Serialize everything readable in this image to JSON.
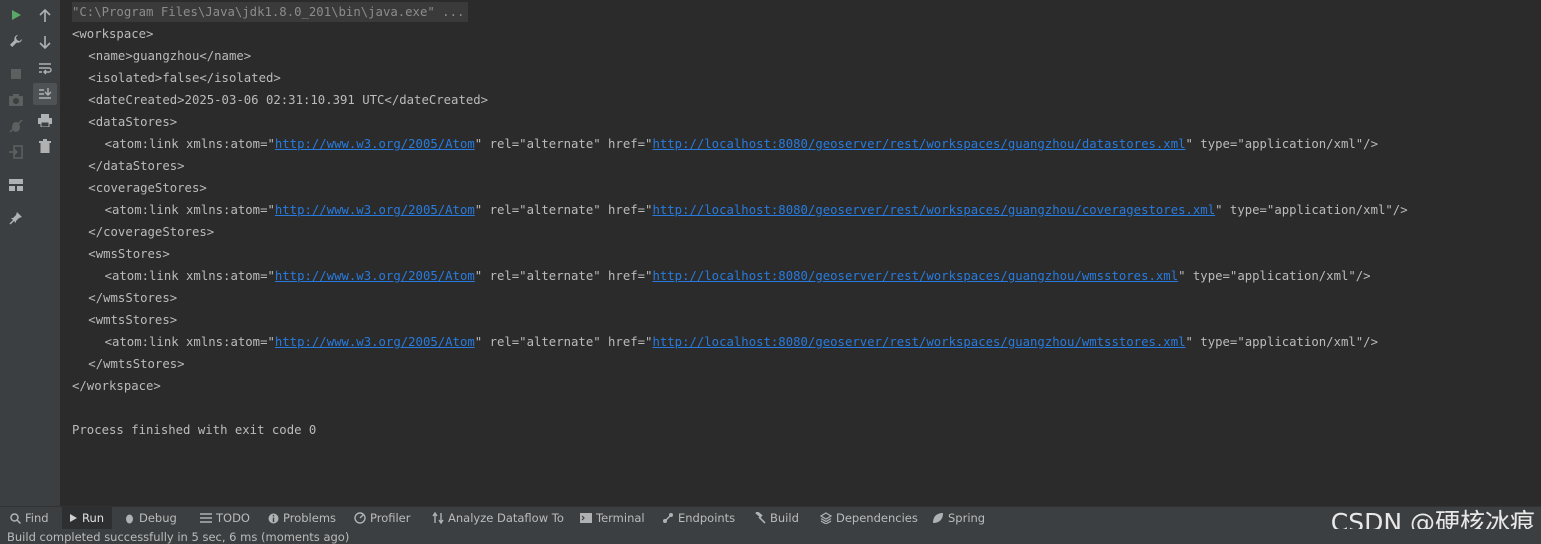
{
  "toolbar_left": {
    "icons": [
      "run-icon",
      "wrench-icon",
      "stop-icon",
      "camera-icon",
      "bug-exclude-icon",
      "login-icon",
      "layout-icon",
      "pin-icon"
    ]
  },
  "toolbar_left2": {
    "icons": [
      "arrow-up-icon",
      "arrow-down-icon",
      "soft-wrap-icon",
      "scroll-to-end-icon",
      "print-icon",
      "trash-icon"
    ]
  },
  "console": {
    "command": "\"C:\\Program Files\\Java\\jdk1.8.0_201\\bin\\java.exe\" ...",
    "lines": [
      {
        "indent": 0,
        "text": "<workspace>"
      },
      {
        "indent": 1,
        "text": "<name>guangzhou</name>"
      },
      {
        "indent": 1,
        "text": "<isolated>false</isolated>"
      },
      {
        "indent": 1,
        "text": "<dateCreated>2025-03-06 02:31:10.391 UTC</dateCreated>"
      },
      {
        "indent": 1,
        "text": "<dataStores>"
      },
      {
        "indent": 2,
        "pre": "<atom:link xmlns:atom=\"",
        "link1": "http://www.w3.org/2005/Atom",
        "mid": "\" rel=\"alternate\" href=\"",
        "link2": "http://localhost:8080/geoserver/rest/workspaces/guangzhou/datastores.xml",
        "post": "\" type=\"application/xml\"/>"
      },
      {
        "indent": 1,
        "text": "</dataStores>"
      },
      {
        "indent": 1,
        "text": "<coverageStores>"
      },
      {
        "indent": 2,
        "pre": "<atom:link xmlns:atom=\"",
        "link1": "http://www.w3.org/2005/Atom",
        "mid": "\" rel=\"alternate\" href=\"",
        "link2": "http://localhost:8080/geoserver/rest/workspaces/guangzhou/coveragestores.xml",
        "post": "\" type=\"application/xml\"/>"
      },
      {
        "indent": 1,
        "text": "</coverageStores>"
      },
      {
        "indent": 1,
        "text": "<wmsStores>"
      },
      {
        "indent": 2,
        "pre": "<atom:link xmlns:atom=\"",
        "link1": "http://www.w3.org/2005/Atom",
        "mid": "\" rel=\"alternate\" href=\"",
        "link2": "http://localhost:8080/geoserver/rest/workspaces/guangzhou/wmsstores.xml",
        "post": "\" type=\"application/xml\"/>"
      },
      {
        "indent": 1,
        "text": "</wmsStores>"
      },
      {
        "indent": 1,
        "text": "<wmtsStores>"
      },
      {
        "indent": 2,
        "pre": "<atom:link xmlns:atom=\"",
        "link1": "http://www.w3.org/2005/Atom",
        "mid": "\" rel=\"alternate\" href=\"",
        "link2": "http://localhost:8080/geoserver/rest/workspaces/guangzhou/wmtsstores.xml",
        "post": "\" type=\"application/xml\"/>"
      },
      {
        "indent": 1,
        "text": "</wmtsStores>"
      },
      {
        "indent": 0,
        "text": "</workspace>"
      },
      {
        "indent": 0,
        "text": ""
      },
      {
        "indent": 0,
        "text": "Process finished with exit code 0"
      }
    ]
  },
  "bottom_tabs": [
    {
      "label": "Find",
      "icon": "search-icon",
      "active": false
    },
    {
      "label": "Run",
      "icon": "run-icon",
      "active": true
    },
    {
      "label": "Debug",
      "icon": "bug-icon",
      "active": false
    },
    {
      "label": "TODO",
      "icon": "list-icon",
      "active": false
    },
    {
      "label": "Problems",
      "icon": "info-icon",
      "active": false
    },
    {
      "label": "Profiler",
      "icon": "profiler-icon",
      "active": false
    },
    {
      "label": "Analyze Dataflow To",
      "icon": "dataflow-icon",
      "active": false
    },
    {
      "label": "Terminal",
      "icon": "terminal-icon",
      "active": false
    },
    {
      "label": "Endpoints",
      "icon": "endpoints-icon",
      "active": false
    },
    {
      "label": "Build",
      "icon": "hammer-icon",
      "active": false
    },
    {
      "label": "Dependencies",
      "icon": "layers-icon",
      "active": false
    },
    {
      "label": "Spring",
      "icon": "spring-icon",
      "active": false
    }
  ],
  "watermark": "CSDN @硬核冰痕",
  "status": {
    "text": "Build completed successfully in 5 sec, 6 ms (moments ago)"
  },
  "colors": {
    "link": "#287bde",
    "console_bg": "#2b2b2b",
    "panel_bg": "#3c3f41",
    "run_green": "#59a869"
  }
}
